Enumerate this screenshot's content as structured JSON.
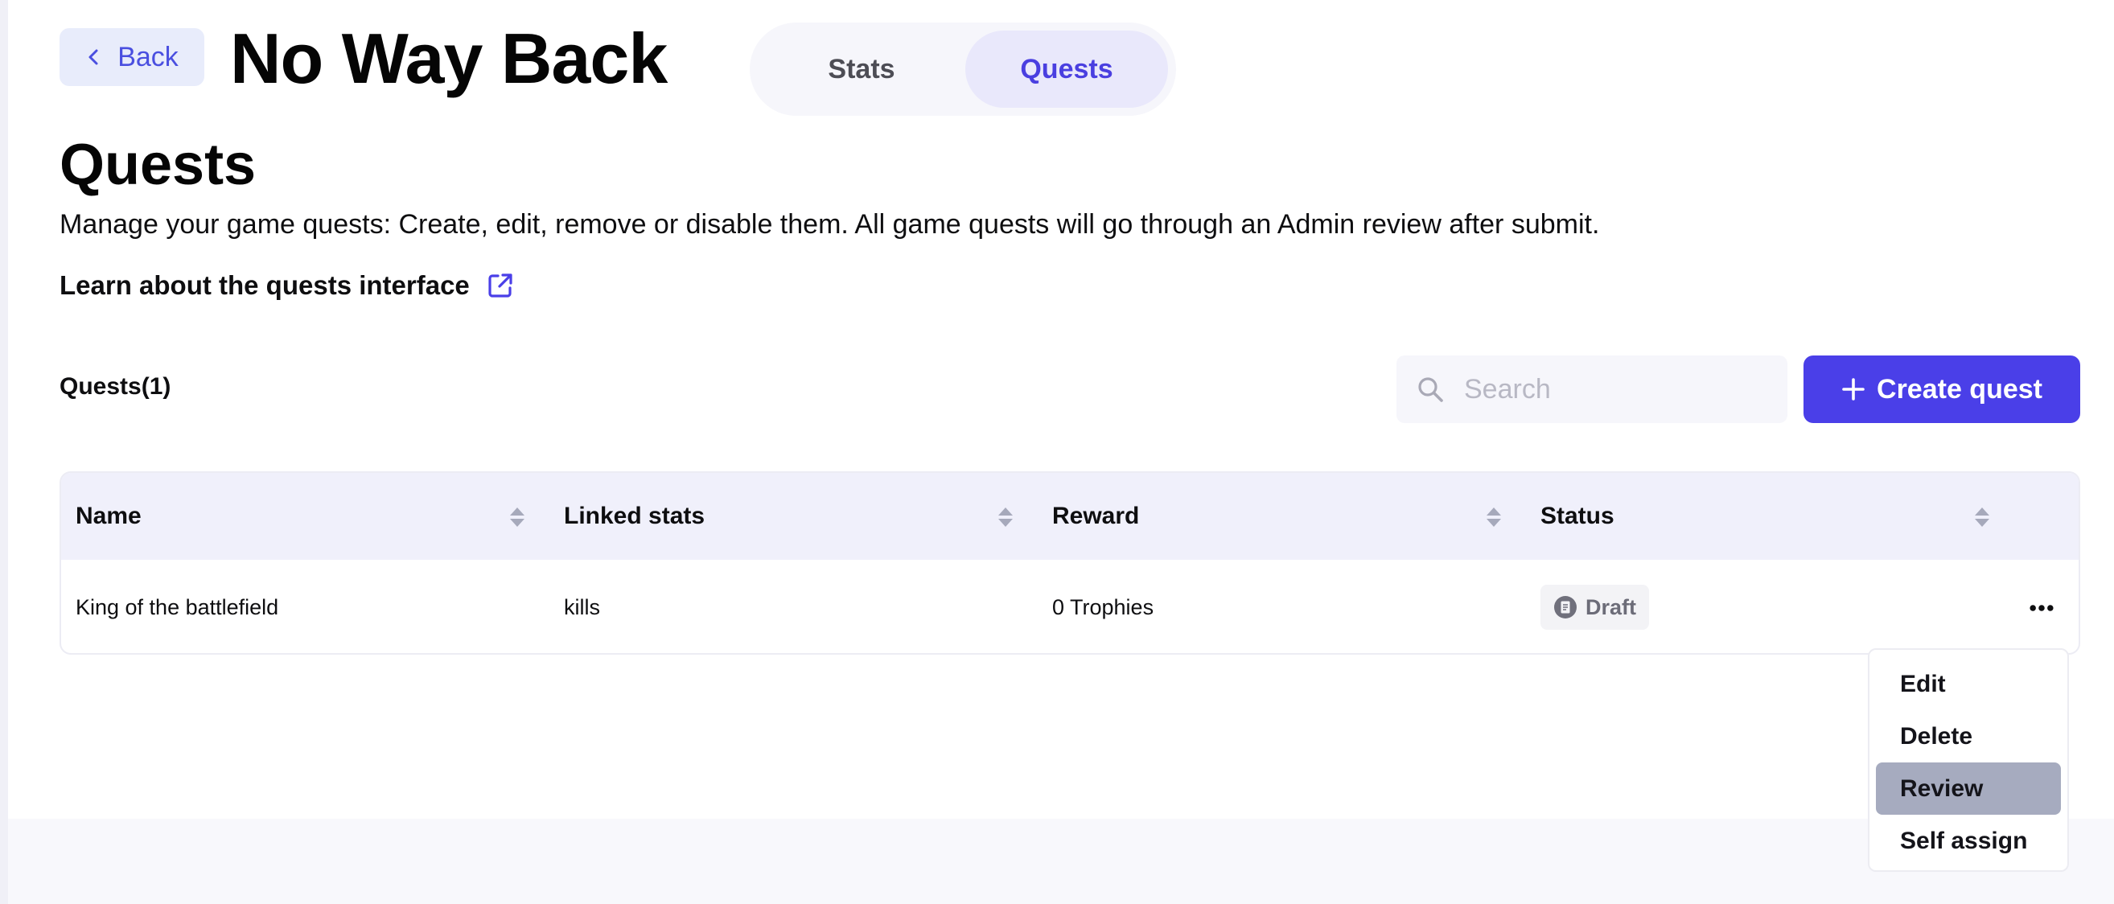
{
  "header": {
    "back_label": "Back",
    "game_title": "No Way Back",
    "tabs": [
      {
        "label": "Stats",
        "active": false
      },
      {
        "label": "Quests",
        "active": true
      }
    ]
  },
  "section": {
    "title": "Quests",
    "description": "Manage your game quests: Create, edit, remove or disable them. All game quests will go through an Admin review after submit.",
    "learn_link": "Learn about the quests interface"
  },
  "toolbar": {
    "count_label": "Quests(1)",
    "search_placeholder": "Search",
    "search_value": "",
    "create_label": "Create quest"
  },
  "table": {
    "columns": [
      "Name",
      "Linked stats",
      "Reward",
      "Status"
    ],
    "rows": [
      {
        "name": "King of the battlefield",
        "linked_stats": "kills",
        "reward": "0 Trophies",
        "status": "Draft"
      }
    ]
  },
  "context_menu": {
    "items": [
      {
        "label": "Edit",
        "highlighted": false
      },
      {
        "label": "Delete",
        "highlighted": false
      },
      {
        "label": "Review",
        "highlighted": true
      },
      {
        "label": "Self assign",
        "highlighted": false
      }
    ]
  },
  "colors": {
    "accent": "#4a3fe8",
    "tab_active_bg": "#e9e8fb",
    "table_header_bg": "#f0f0fb",
    "menu_highlight": "#a6abbf"
  },
  "icons": {
    "back": "chevron-left-icon",
    "external_link": "external-link-icon",
    "search": "search-icon",
    "create": "plus-icon",
    "sort": "sort-icon",
    "status": "document-icon",
    "more": "more-horizontal-icon"
  }
}
